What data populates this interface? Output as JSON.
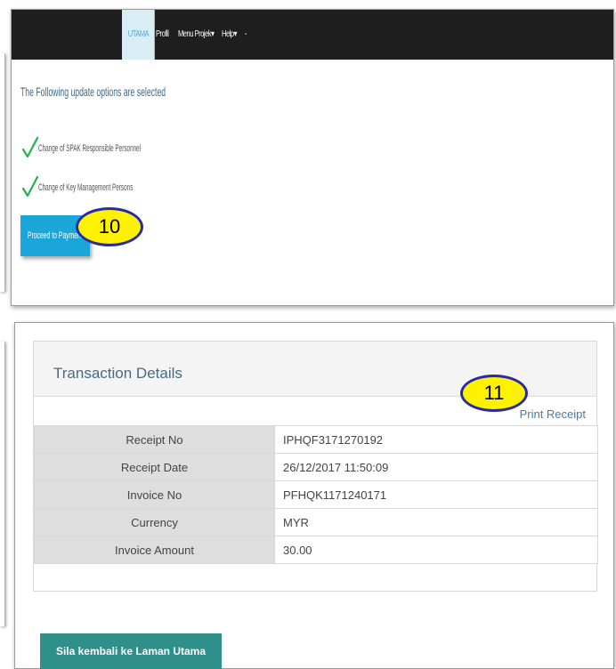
{
  "navbar": {
    "items": [
      "UTAMA",
      "Profil",
      "Menu Projek",
      "Help",
      "-"
    ],
    "item_separator_arrow": "▾"
  },
  "update_options": {
    "heading": "The Following update options are selected",
    "options": [
      "Change of SPAK Responsible Personnel",
      "Change of Key Management Persons"
    ],
    "proceed_button": "Proceed to Payment"
  },
  "callouts": {
    "step_10": "10",
    "step_11": "11"
  },
  "transaction": {
    "title": "Transaction Details",
    "print_receipt": "Print Receipt",
    "rows": [
      {
        "label": "Receipt No",
        "value": "IPHQF3171270192"
      },
      {
        "label": "Receipt Date",
        "value": "26/12/2017 11:50:09"
      },
      {
        "label": "Invoice No",
        "value": "PFHQK1171240171"
      },
      {
        "label": "Currency",
        "value": "MYR"
      },
      {
        "label": "Invoice Amount",
        "value": "30.00"
      }
    ]
  },
  "back_button": "Sila kembali ke Laman Utama",
  "colors": {
    "navbar": "#1e1e1e",
    "active_tab": "#d9edf5",
    "proceed_button": "#1aa6d9",
    "back_button": "#2f8f8a",
    "callout_fill": "#fff200",
    "callout_border": "#2a2aa8",
    "checkmark": "#22b14c"
  },
  "icons": [
    "check-icon"
  ]
}
